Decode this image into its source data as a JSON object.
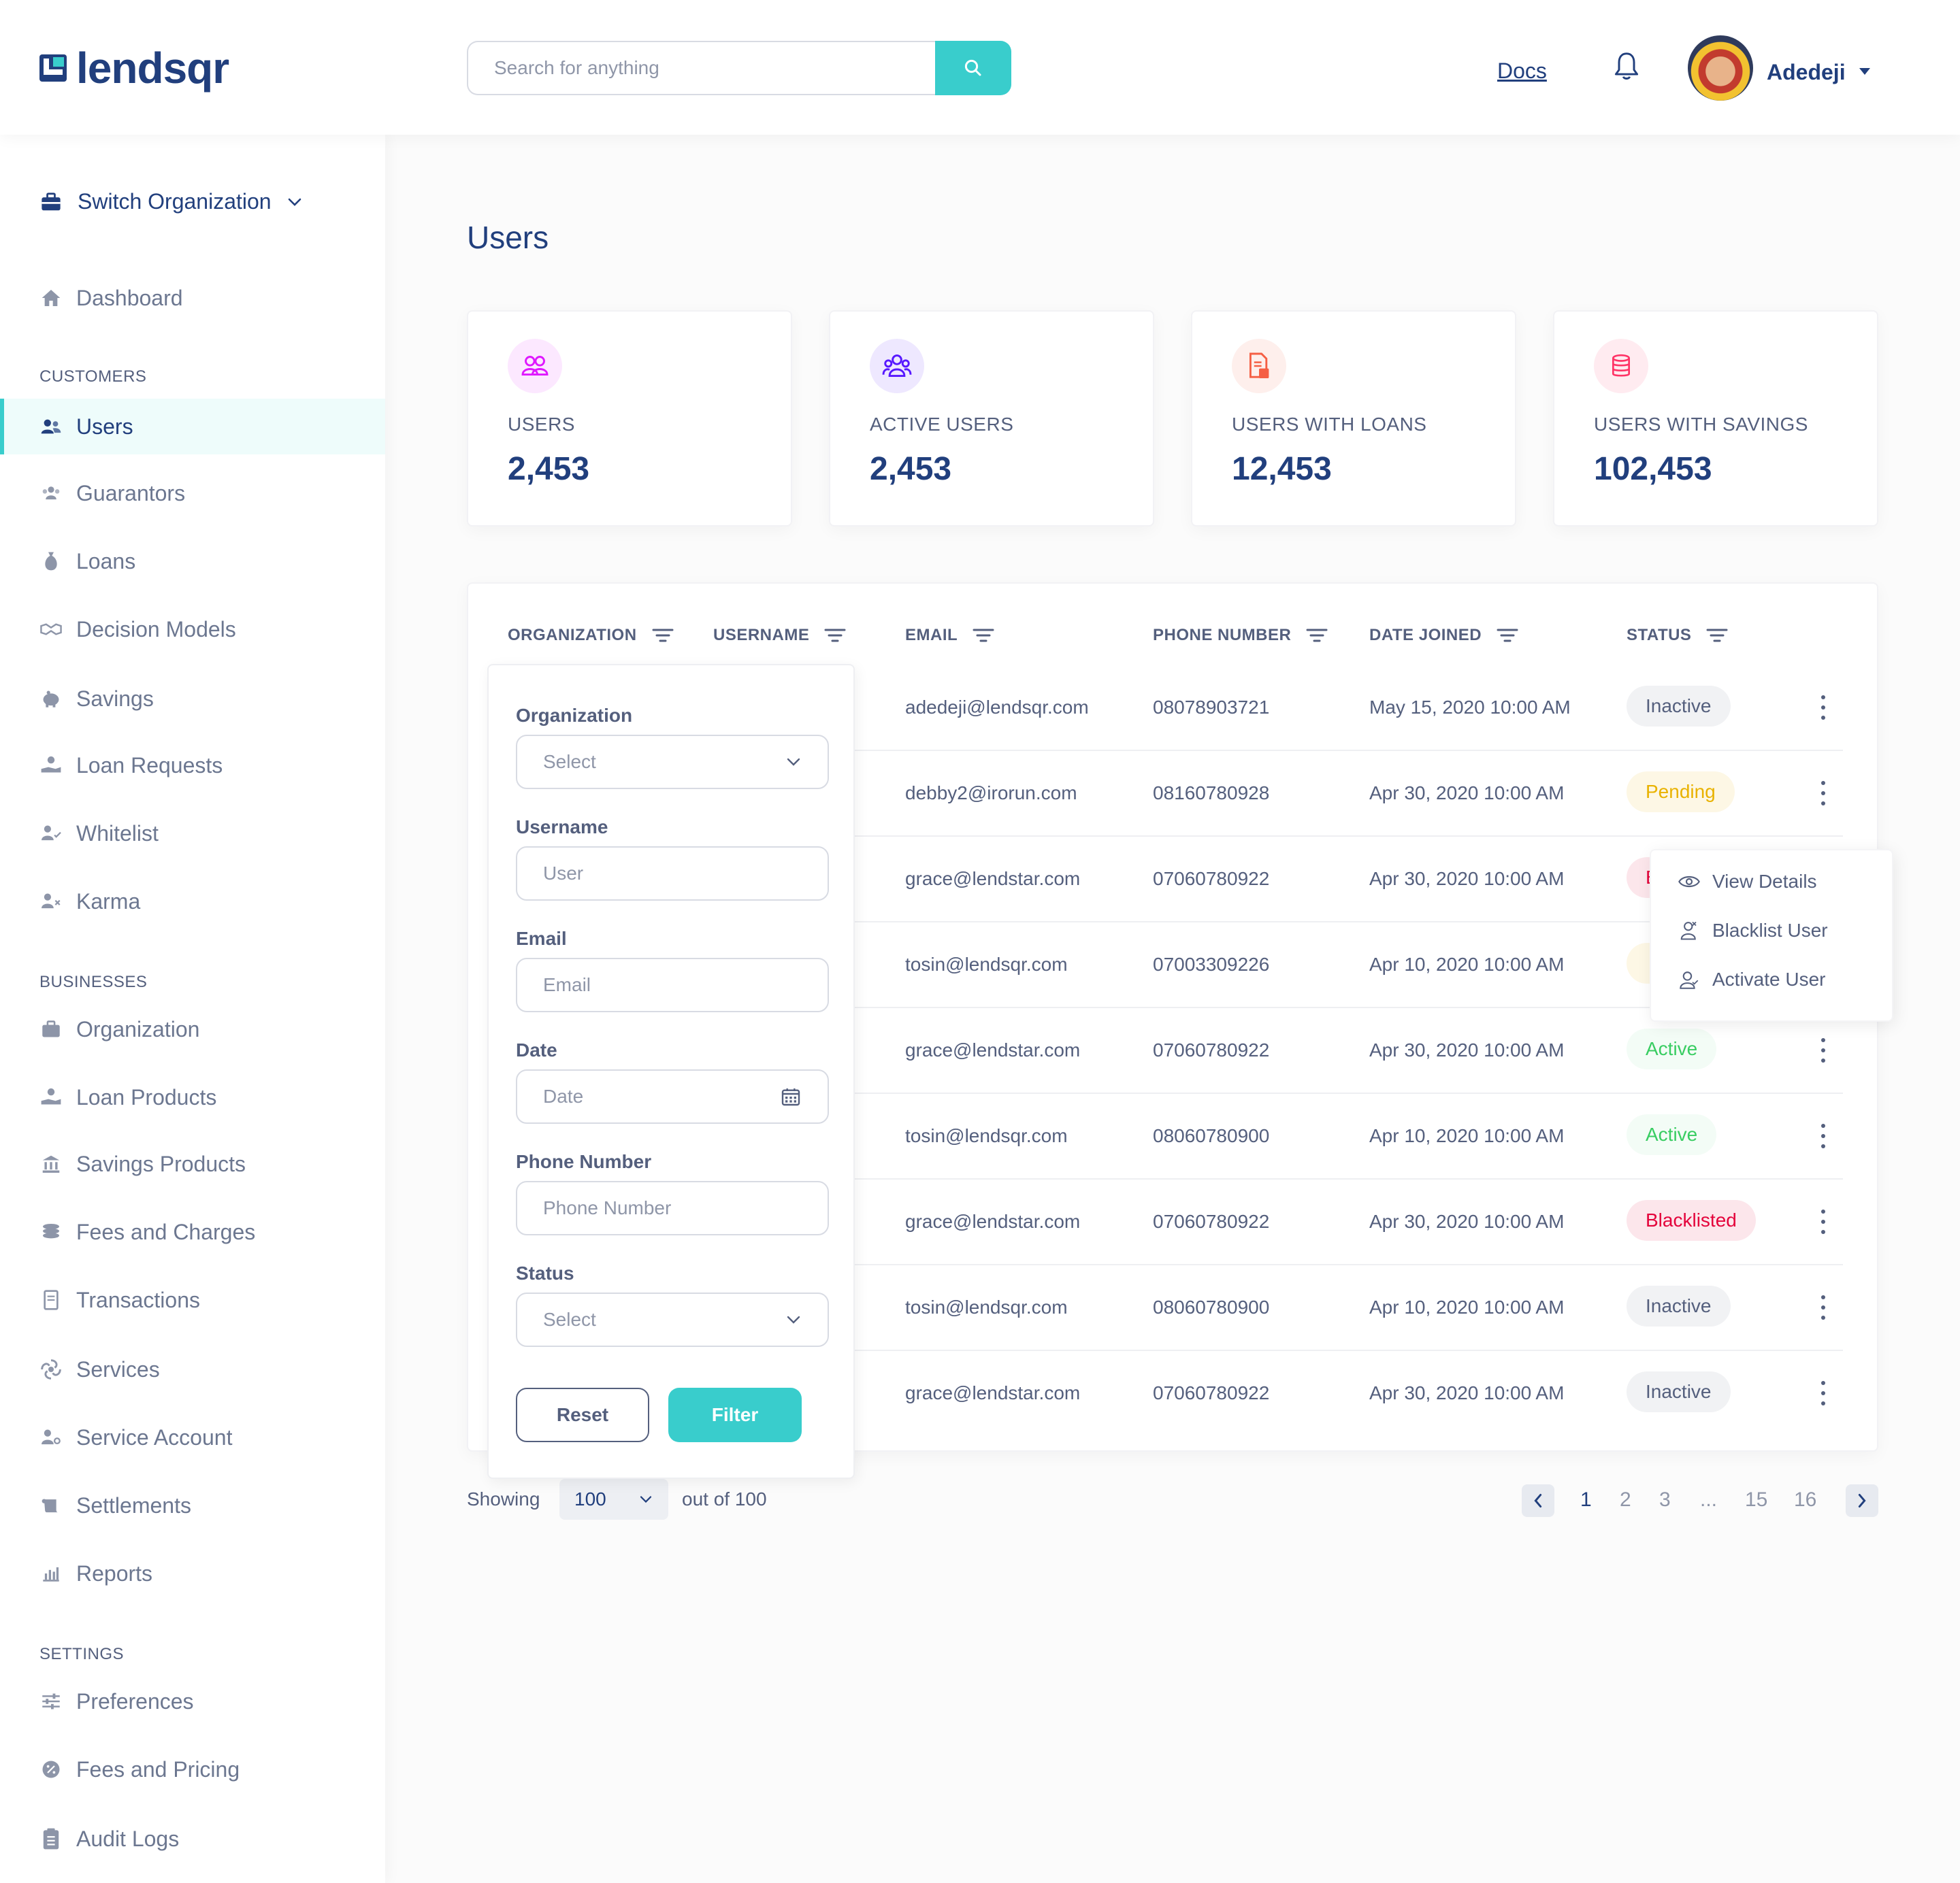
{
  "header": {
    "logo_text": "lendsqr",
    "search_placeholder": "Search for anything",
    "docs_label": "Docs",
    "user_name": "Adedeji"
  },
  "sidebar": {
    "switch_org_label": "Switch Organization",
    "dashboard_label": "Dashboard",
    "sections": {
      "customers": "CUSTOMERS",
      "businesses": "BUSINESSES",
      "settings": "SETTINGS"
    },
    "customers": [
      "Users",
      "Guarantors",
      "Loans",
      "Decision Models",
      "Savings",
      "Loan Requests",
      "Whitelist",
      "Karma"
    ],
    "businesses": [
      "Organization",
      "Loan Products",
      "Savings Products",
      "Fees and Charges",
      "Transactions",
      "Services",
      "Service Account",
      "Settlements",
      "Reports"
    ],
    "settings": [
      "Preferences",
      "Fees and Pricing",
      "Audit Logs"
    ]
  },
  "page_title": "Users",
  "stats": [
    {
      "label": "USERS",
      "value": "2,453",
      "icon": "users-icon",
      "color": "#DF18FF"
    },
    {
      "label": "ACTIVE USERS",
      "value": "2,453",
      "icon": "active-users-icon",
      "color": "#5718FF"
    },
    {
      "label": "USERS WITH LOANS",
      "value": "12,453",
      "icon": "loan-document-icon",
      "color": "#F55F44"
    },
    {
      "label": "USERS WITH SAVINGS",
      "value": "102,453",
      "icon": "coins-icon",
      "color": "#FF3366"
    }
  ],
  "table": {
    "columns": [
      "ORGANIZATION",
      "USERNAME",
      "EMAIL",
      "PHONE NUMBER",
      "DATE JOINED",
      "STATUS"
    ],
    "rows": [
      {
        "email": "adedeji@lendsqr.com",
        "phone": "08078903721",
        "date": "May 15, 2020 10:00 AM",
        "status": "Inactive"
      },
      {
        "email": "debby2@irorun.com",
        "phone": "08160780928",
        "date": "Apr 30, 2020 10:00 AM",
        "status": "Pending"
      },
      {
        "email": "grace@lendstar.com",
        "phone": "07060780922",
        "date": "Apr 30, 2020 10:00 AM",
        "status": "B"
      },
      {
        "email": "tosin@lendsqr.com",
        "phone": "07003309226",
        "date": "Apr 10, 2020 10:00 AM",
        "status": ""
      },
      {
        "email": "grace@lendstar.com",
        "phone": "07060780922",
        "date": "Apr 30, 2020 10:00 AM",
        "status": "Active"
      },
      {
        "email": "tosin@lendsqr.com",
        "phone": "08060780900",
        "date": "Apr 10, 2020 10:00 AM",
        "status": "Active"
      },
      {
        "email": "grace@lendstar.com",
        "phone": "07060780922",
        "date": "Apr 30, 2020 10:00 AM",
        "status": "Blacklisted"
      },
      {
        "email": "tosin@lendsqr.com",
        "phone": "08060780900",
        "date": "Apr 10, 2020 10:00 AM",
        "status": "Inactive"
      },
      {
        "email": "grace@lendstar.com",
        "phone": "07060780922",
        "date": "Apr 30, 2020 10:00 AM",
        "status": "Inactive"
      }
    ]
  },
  "filter": {
    "organization_label": "Organization",
    "organization_placeholder": "Select",
    "username_label": "Username",
    "username_placeholder": "User",
    "email_label": "Email",
    "email_placeholder": "Email",
    "date_label": "Date",
    "date_placeholder": "Date",
    "phone_label": "Phone Number",
    "phone_placeholder": "Phone Number",
    "status_label": "Status",
    "status_placeholder": "Select",
    "reset_label": "Reset",
    "filter_label": "Filter"
  },
  "action_menu": [
    "View Details",
    "Blacklist User",
    "Activate User"
  ],
  "pagination": {
    "showing_label": "Showing",
    "per_page": "100",
    "out_of_label": "out of 100",
    "pages": [
      "1",
      "2",
      "3",
      "...",
      "15",
      "16"
    ],
    "current": "1"
  },
  "colors": {
    "primary": "#213F7D",
    "accent": "#39CDCC",
    "text": "#545F7D"
  }
}
